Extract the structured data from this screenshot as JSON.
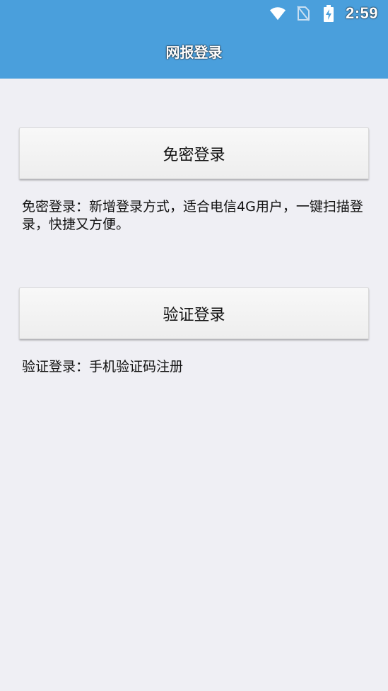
{
  "status_bar": {
    "time": "2:59",
    "icons": [
      "wifi-icon",
      "no-sim-icon",
      "battery-charging-icon"
    ]
  },
  "app_bar": {
    "title": "网报登录"
  },
  "main": {
    "password_free": {
      "button_label": "免密登录",
      "description": "免密登录：新增登录方式，适合电信4G用户，一键扫描登录，快捷又方便。"
    },
    "verify": {
      "button_label": "验证登录",
      "description": "验证登录：手机验证码注册"
    }
  },
  "colors": {
    "header": "#4a9fdc",
    "background": "#efeff4",
    "button": "#f5f5f5"
  }
}
